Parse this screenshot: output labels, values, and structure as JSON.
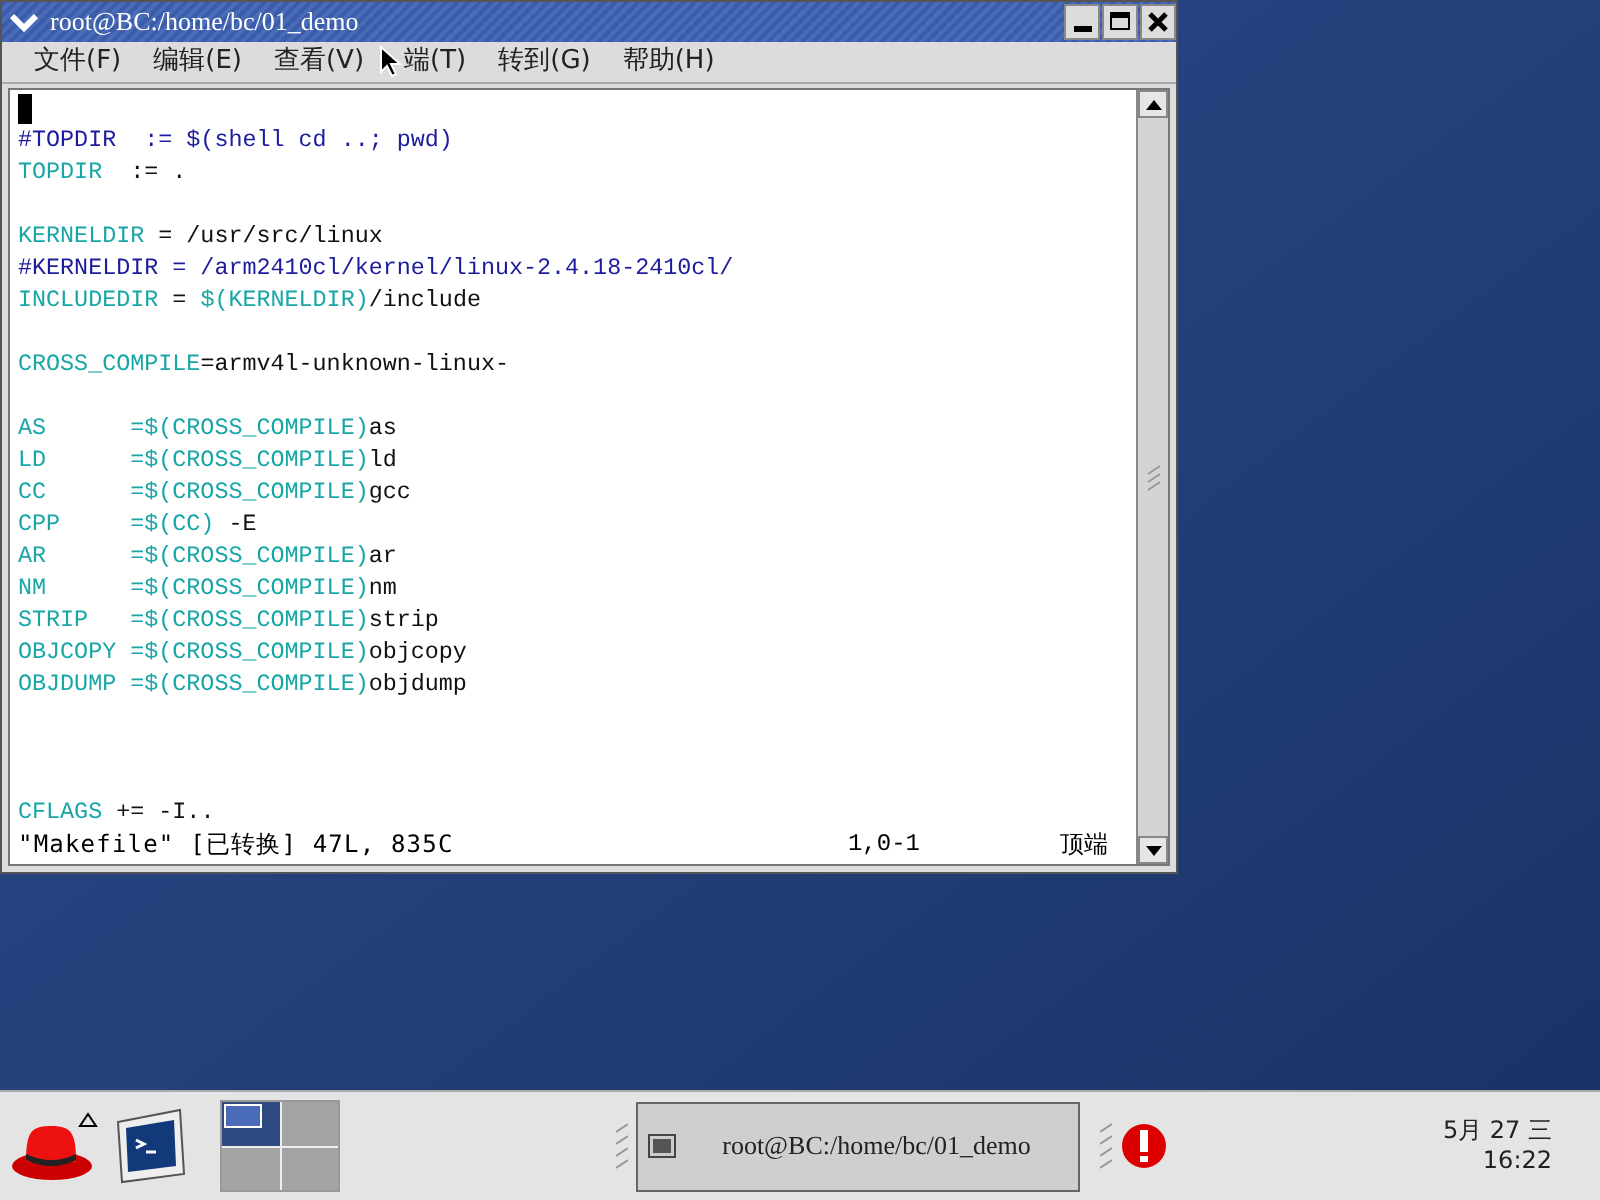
{
  "window": {
    "title": "root@BC:/home/bc/01_demo"
  },
  "menu": [
    "文件(F)",
    "编辑(E)",
    "查看(V)",
    "端(T)",
    "转到(G)",
    "帮助(H)"
  ],
  "editor": {
    "lines": [
      {
        "kind": "cursor"
      },
      {
        "kind": "code",
        "segments": [
          {
            "text": "#TOPDIR  := $(shell cd ..; pwd)",
            "kind": "comment"
          }
        ]
      },
      {
        "kind": "code",
        "segments": [
          {
            "text": "TOPDIR",
            "kind": "identifier"
          },
          {
            "text": "  := .",
            "kind": "plain"
          }
        ]
      },
      {
        "kind": "blank"
      },
      {
        "kind": "code",
        "segments": [
          {
            "text": "KERNELDIR",
            "kind": "identifier"
          },
          {
            "text": " = /usr/src/linux",
            "kind": "plain"
          }
        ]
      },
      {
        "kind": "code",
        "segments": [
          {
            "text": "#KERNELDIR = /arm2410cl/kernel/linux-2.4.18-2410cl/",
            "kind": "comment"
          }
        ]
      },
      {
        "kind": "code",
        "segments": [
          {
            "text": "INCLUDEDIR",
            "kind": "identifier"
          },
          {
            "text": " = ",
            "kind": "plain"
          },
          {
            "text": "$(KERNELDIR)",
            "kind": "identifier"
          },
          {
            "text": "/include",
            "kind": "plain"
          }
        ]
      },
      {
        "kind": "blank"
      },
      {
        "kind": "code",
        "segments": [
          {
            "text": "CROSS_COMPILE",
            "kind": "identifier"
          },
          {
            "text": "=armv4l-unknown-linux-",
            "kind": "plain"
          }
        ]
      },
      {
        "kind": "blank"
      },
      {
        "kind": "code",
        "segments": [
          {
            "text": "AS      =$(CROSS_COMPILE)",
            "kind": "identifier"
          },
          {
            "text": "as",
            "kind": "plain"
          }
        ]
      },
      {
        "kind": "code",
        "segments": [
          {
            "text": "LD      =$(CROSS_COMPILE)",
            "kind": "identifier"
          },
          {
            "text": "ld",
            "kind": "plain"
          }
        ]
      },
      {
        "kind": "code",
        "segments": [
          {
            "text": "CC      =$(CROSS_COMPILE)",
            "kind": "identifier"
          },
          {
            "text": "gcc",
            "kind": "plain"
          }
        ]
      },
      {
        "kind": "code",
        "segments": [
          {
            "text": "CPP     =$(CC)",
            "kind": "identifier"
          },
          {
            "text": " -E",
            "kind": "plain"
          }
        ]
      },
      {
        "kind": "code",
        "segments": [
          {
            "text": "AR      =$(CROSS_COMPILE)",
            "kind": "identifier"
          },
          {
            "text": "ar",
            "kind": "plain"
          }
        ]
      },
      {
        "kind": "code",
        "segments": [
          {
            "text": "NM      =$(CROSS_COMPILE)",
            "kind": "identifier"
          },
          {
            "text": "nm",
            "kind": "plain"
          }
        ]
      },
      {
        "kind": "code",
        "segments": [
          {
            "text": "STRIP   =$(CROSS_COMPILE)",
            "kind": "identifier"
          },
          {
            "text": "strip",
            "kind": "plain"
          }
        ]
      },
      {
        "kind": "code",
        "segments": [
          {
            "text": "OBJCOPY =$(CROSS_COMPILE)",
            "kind": "identifier"
          },
          {
            "text": "objcopy",
            "kind": "plain"
          }
        ]
      },
      {
        "kind": "code",
        "segments": [
          {
            "text": "OBJDUMP =$(CROSS_COMPILE)",
            "kind": "identifier"
          },
          {
            "text": "objdump",
            "kind": "plain"
          }
        ]
      },
      {
        "kind": "blank"
      },
      {
        "kind": "blank"
      },
      {
        "kind": "blank"
      },
      {
        "kind": "code",
        "segments": [
          {
            "text": "CFLAGS",
            "kind": "identifier"
          },
          {
            "text": " += -I..",
            "kind": "plain"
          }
        ]
      }
    ],
    "status": {
      "message": "\"Makefile\" [已转换] 47L, 835C",
      "position": "1,0-1",
      "scroll": "顶端"
    }
  },
  "taskbar": {
    "pager": [
      {
        "selected": true
      },
      {
        "selected": false
      },
      {
        "selected": false
      },
      {
        "selected": false
      }
    ],
    "task": {
      "label": "root@BC:/home/bc/01_demo"
    },
    "clock": {
      "date": "5月 27 三",
      "time": "16:22"
    }
  }
}
